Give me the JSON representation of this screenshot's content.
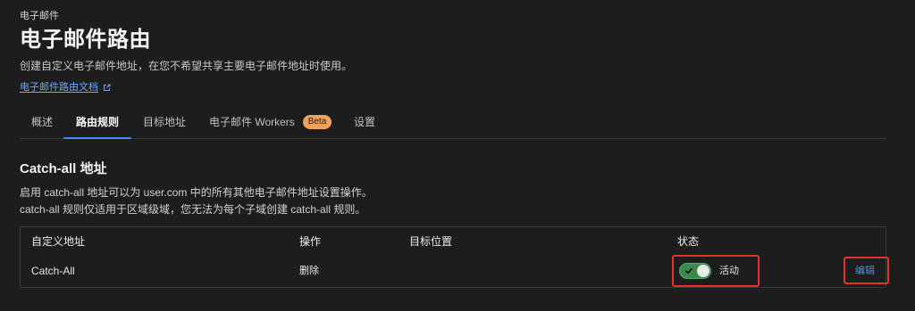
{
  "breadcrumb": "电子邮件",
  "page": {
    "title": "电子邮件路由",
    "description": "创建自定义电子邮件地址，在您不希望共享主要电子邮件地址时使用。",
    "docs_link": {
      "label": "电子邮件路由文档",
      "icon": "external-link-icon"
    }
  },
  "tabs": [
    {
      "label": "概述",
      "active": false
    },
    {
      "label": "路由规则",
      "active": true
    },
    {
      "label": "目标地址",
      "active": false
    },
    {
      "label": "电子邮件 Workers",
      "badge": "Beta",
      "active": false
    },
    {
      "label": "设置",
      "active": false
    }
  ],
  "catch_all": {
    "title": "Catch-all 地址",
    "description": [
      "启用 catch-all 地址可以为 user.com 中的所有其他电子邮件地址设置操作。",
      "catch-all 规则仅适用于区域级域，您无法为每个子域创建 catch-all 规则。"
    ],
    "table": {
      "columns": [
        "自定义地址",
        "操作",
        "目标位置",
        "状态"
      ],
      "rows": [
        {
          "address": "Catch-All",
          "action": "删除",
          "status": "活动",
          "enabled": true,
          "toggle_icon": "check-icon",
          "edit_label": "编辑"
        }
      ]
    }
  },
  "colors": {
    "background": "#1d1d1d",
    "text": "#f0f0f0",
    "accent": "#4b8ef1",
    "badge": "#f4a259",
    "toggle_on": "#3c8a4b",
    "highlight": "#e0352b"
  }
}
